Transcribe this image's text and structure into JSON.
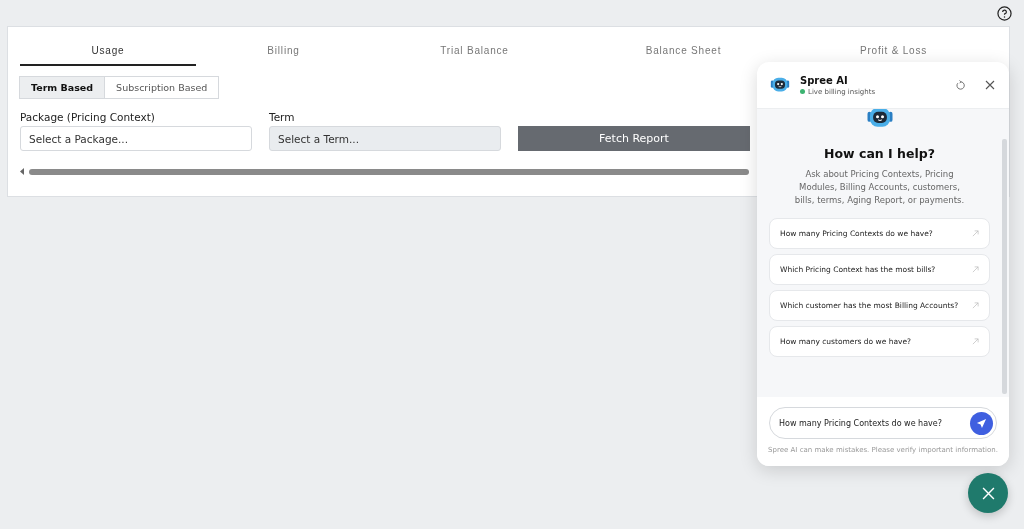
{
  "tabs": [
    {
      "label": "Usage",
      "selected": true
    },
    {
      "label": "Billing",
      "selected": false
    },
    {
      "label": "Trial Balance",
      "selected": false
    },
    {
      "label": "Balance Sheet",
      "selected": false
    },
    {
      "label": "Profit & Loss",
      "selected": false
    }
  ],
  "modes": [
    {
      "label": "Term Based",
      "selected": true
    },
    {
      "label": "Subscription Based",
      "selected": false
    }
  ],
  "fields": [
    {
      "label": "Package (Pricing Context)",
      "placeholder": "Select a Package...",
      "disabled": false
    },
    {
      "label": "Term",
      "placeholder": "Select a Term...",
      "disabled": true
    }
  ],
  "fetch_button": "Fetch Report",
  "chat": {
    "title": "Spree AI",
    "status": "Live billing insights",
    "online": true,
    "heading": "How can I help?",
    "intro": "Ask about Pricing Contexts, Pricing Modules, Billing Accounts, customers, bills, terms, Aging Report, or payments.",
    "suggestions": [
      "How many Pricing Contexts do we have?",
      "Which Pricing Context has the most bills?",
      "Which customer has the most Billing Accounts?",
      "How many customers do we have?"
    ],
    "input": "How many Pricing Contexts do we have?",
    "disclaimer": "Spree AI can make mistakes. Please verify important information."
  }
}
